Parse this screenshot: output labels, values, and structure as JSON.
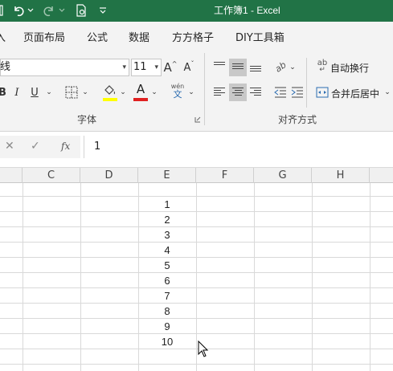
{
  "titlebar": {
    "title": "工作簿1  -  Excel",
    "qa_undo": "↶",
    "qa_redo": "↷",
    "qa_arrow": "⌄",
    "qa_customize": "⌄"
  },
  "menu": {
    "tabs": [
      "页面布局",
      "公式",
      "数据",
      "方方格子",
      "DIY工具箱"
    ],
    "partial_tab": "入"
  },
  "ribbon": {
    "font_name": "等线",
    "font_size": "11",
    "grow_font": "A",
    "shrink_font": "A",
    "bold": "B",
    "italic": "I",
    "underline": "U",
    "font_group_label": "字体",
    "align_group_label": "对齐方式",
    "wrap_text": "自动换行",
    "merge_center": "合并后居中",
    "phonetic_top": "wén",
    "phonetic_bottom": "文",
    "orientation": "ab",
    "wrap_prefix": "ab",
    "highlight_color": "#ffff00",
    "font_color": "#e02020"
  },
  "formula_bar": {
    "cancel": "✕",
    "enter": "✓",
    "fx": "fx",
    "value": "1"
  },
  "grid": {
    "columns": [
      "C",
      "D",
      "E",
      "F",
      "G",
      "H"
    ],
    "values": [
      "1",
      "2",
      "3",
      "4",
      "5",
      "6",
      "7",
      "8",
      "9",
      "10"
    ]
  }
}
